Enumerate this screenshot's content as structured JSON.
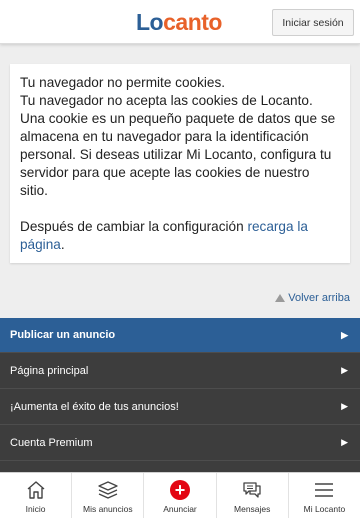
{
  "header": {
    "logo_part1": "Lo",
    "logo_part2": "canto",
    "login_label": "Iniciar sesión"
  },
  "notice": {
    "line1": "Tu navegador no permite cookies.",
    "paragraph": "Tu navegador no acepta las cookies de Locanto. Una cookie es un pequeño paquete de datos que se almacena en tu navegador para la identificación personal. Si deseas utilizar Mi Locanto, configura tu servidor para que acepte las cookies de nuestro sitio.",
    "after_text": "Después de cambiar la configuración ",
    "reload_link": "recarga la página",
    "end": "."
  },
  "back_top_label": "Volver arriba",
  "menu": {
    "items": [
      {
        "label": "Publicar un anuncio"
      },
      {
        "label": "Página principal"
      },
      {
        "label": "¡Aumenta el éxito de tus anuncios!"
      },
      {
        "label": "Cuenta Premium"
      }
    ],
    "arrow": "▶"
  },
  "bottom_nav": {
    "items": [
      {
        "label": "Inicio",
        "icon": "home-icon"
      },
      {
        "label": "Mis anuncios",
        "icon": "stack-icon"
      },
      {
        "label": "Anunciar",
        "icon": "plus-icon"
      },
      {
        "label": "Mensajes",
        "icon": "chat-icon"
      },
      {
        "label": "Mi Locanto",
        "icon": "hamburger-icon"
      }
    ]
  },
  "colors": {
    "brand_blue": "#2c5f96",
    "brand_orange": "#e8622a",
    "menu_dark": "#3d3d3d",
    "plus_red": "#e30613"
  }
}
